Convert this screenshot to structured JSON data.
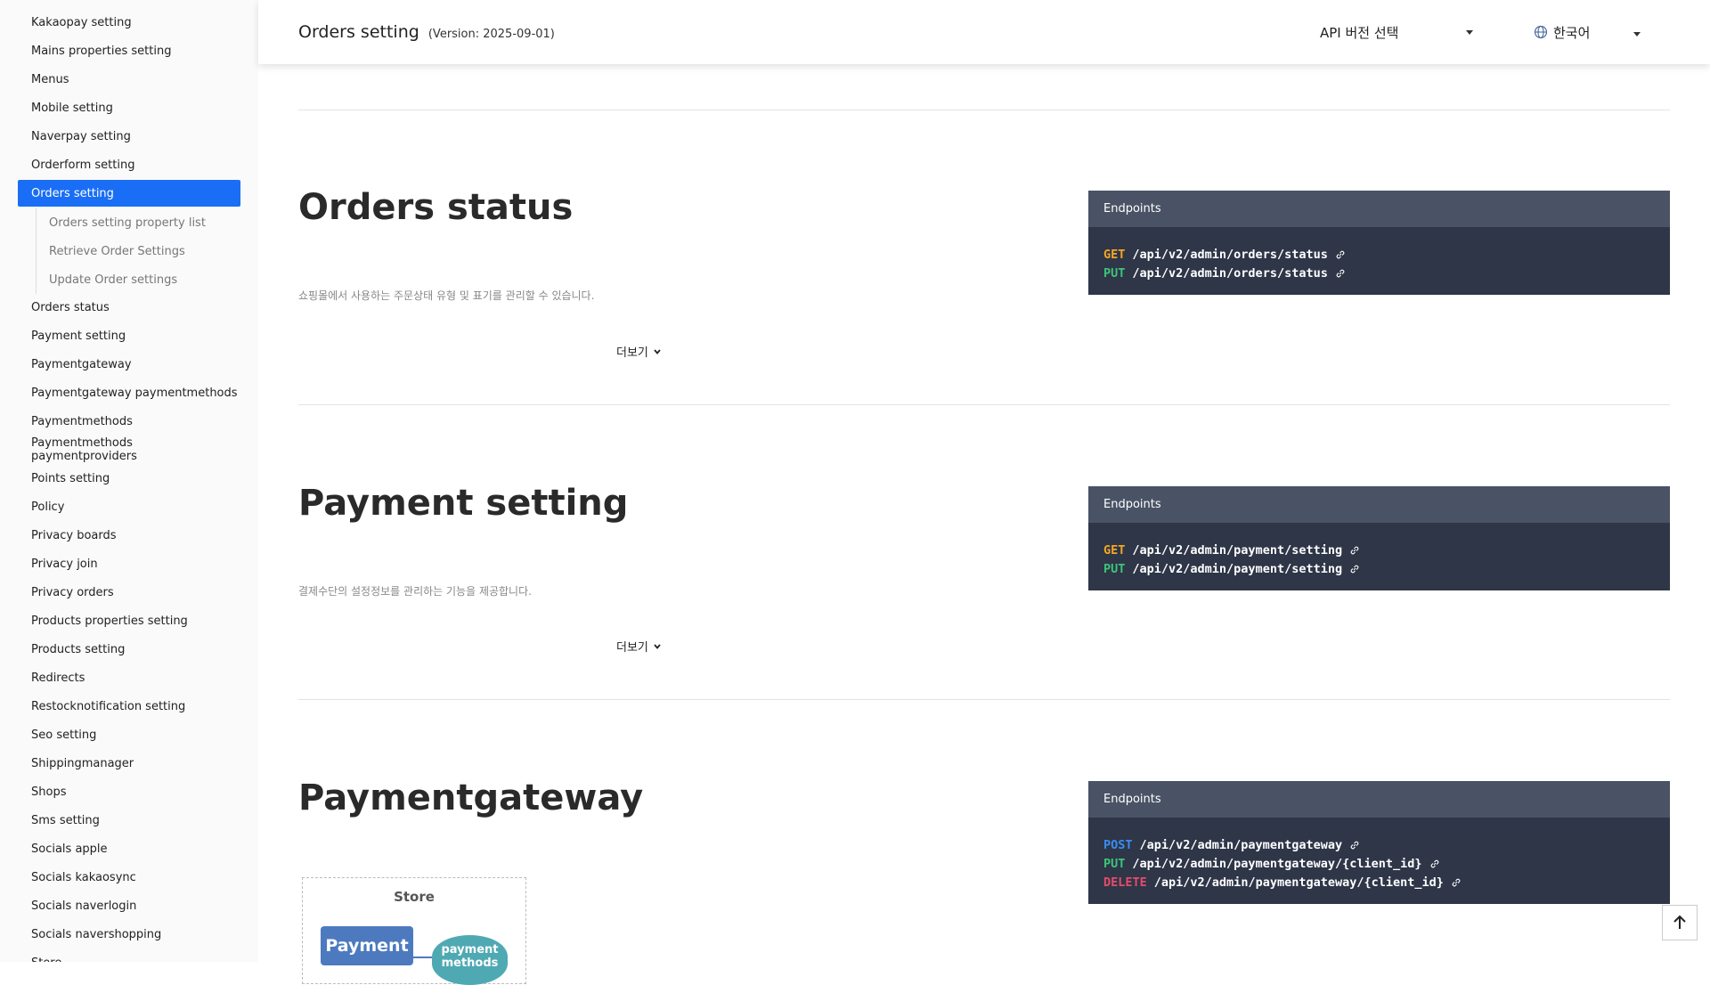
{
  "sidebar": {
    "items_before": [
      "Kakaopay setting",
      "Mains properties setting",
      "Menus",
      "Mobile setting",
      "Naverpay setting",
      "Orderform setting"
    ],
    "active_item": "Orders setting",
    "sub_items": [
      "Orders setting property list",
      "Retrieve Order Settings",
      "Update Order settings"
    ],
    "items_after": [
      "Orders status",
      "Payment setting",
      "Paymentgateway",
      "Paymentgateway paymentmethods",
      "Paymentmethods",
      "Paymentmethods paymentproviders",
      "Points setting",
      "Policy",
      "Privacy boards",
      "Privacy join",
      "Privacy orders",
      "Products properties setting",
      "Products setting",
      "Redirects",
      "Restocknotification setting",
      "Seo setting",
      "Shippingmanager",
      "Shops",
      "Sms setting",
      "Socials apple",
      "Socials kakaosync",
      "Socials naverlogin",
      "Socials navershopping",
      "Store"
    ]
  },
  "header": {
    "title": "Orders setting",
    "version": "(Version: 2025-09-01)",
    "api_select": "API 버전 선택",
    "language": "한국어"
  },
  "sections": [
    {
      "title": "Orders status",
      "description": "쇼핑몰에서 사용하는 주문상태 유형 및 표기를 관리할 수 있습니다.",
      "more": "더보기",
      "endpoints_label": "Endpoints",
      "endpoints": [
        {
          "method": "GET",
          "path": "/api/v2/admin/orders/status"
        },
        {
          "method": "PUT",
          "path": "/api/v2/admin/orders/status"
        }
      ]
    },
    {
      "title": "Payment setting",
      "description": "결제수단의 설정정보를 관리하는 기능을 제공합니다.",
      "more": "더보기",
      "endpoints_label": "Endpoints",
      "endpoints": [
        {
          "method": "GET",
          "path": "/api/v2/admin/payment/setting"
        },
        {
          "method": "PUT",
          "path": "/api/v2/admin/payment/setting"
        }
      ]
    },
    {
      "title": "Paymentgateway",
      "endpoints_label": "Endpoints",
      "endpoints": [
        {
          "method": "POST",
          "path": "/api/v2/admin/paymentgateway"
        },
        {
          "method": "PUT",
          "path": "/api/v2/admin/paymentgateway/{client_id}"
        },
        {
          "method": "DELETE",
          "path": "/api/v2/admin/paymentgateway/{client_id}"
        }
      ],
      "diagram": {
        "title": "Store",
        "box": "Payment",
        "ellipse": "payment methods"
      }
    }
  ],
  "colors": {
    "accent": "#1a6ef5",
    "get": "#f5a623",
    "put": "#3ec47a",
    "post": "#3c8cf0",
    "delete": "#e54b6a",
    "endpoint_bg": "#2e3648",
    "endpoint_head": "#4a5366"
  },
  "icons": {
    "globe": "globe-icon",
    "chevron": "chevron-down-icon",
    "link": "link-icon",
    "scroll_top": "arrow-up-icon"
  }
}
